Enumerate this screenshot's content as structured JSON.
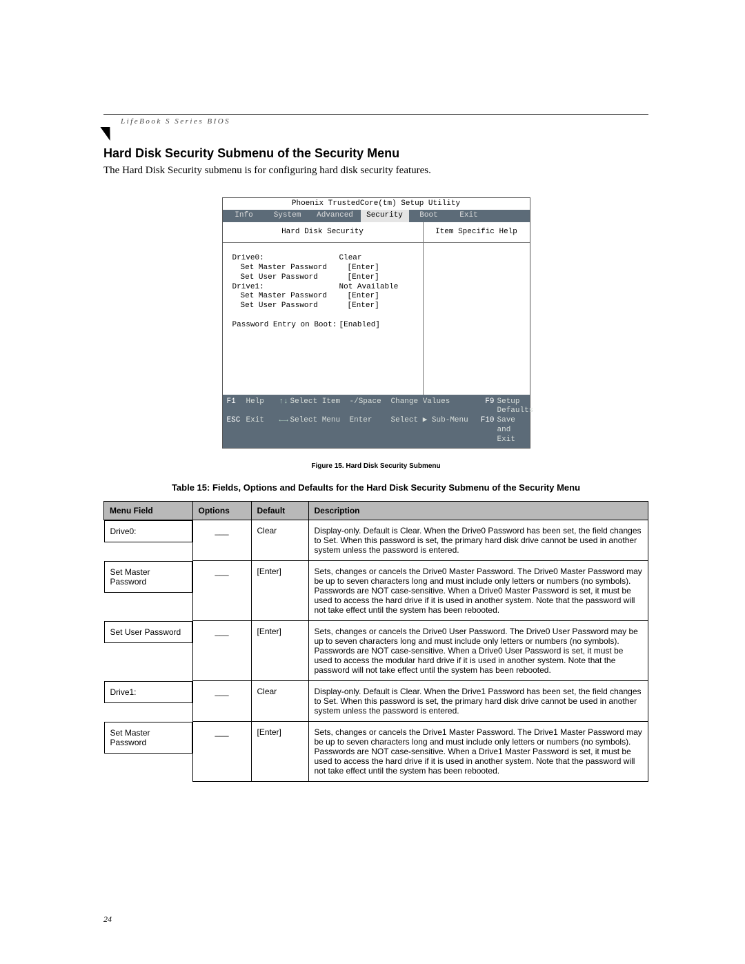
{
  "header": {
    "series": "LifeBook S Series BIOS"
  },
  "section": {
    "title": "Hard Disk Security Submenu of the Security Menu",
    "intro": "The Hard Disk Security submenu is for configuring hard disk security features."
  },
  "bios": {
    "utility_title": "Phoenix TrustedCore(tm) Setup Utility",
    "tabs": [
      "Info",
      "System",
      "Advanced",
      "Security",
      "Boot",
      "Exit"
    ],
    "active_tab": "Security",
    "left_title": "Hard Disk Security",
    "right_title": "Item Specific Help",
    "fields": [
      {
        "label": "Drive0:",
        "value": "Clear",
        "indent": false
      },
      {
        "label": "Set Master Password",
        "value": "[Enter]",
        "indent": true
      },
      {
        "label": "Set User Password",
        "value": "[Enter]",
        "indent": true
      },
      {
        "label": "Drive1:",
        "value": "Not Available",
        "indent": false
      },
      {
        "label": "Set Master Password",
        "value": "[Enter]",
        "indent": true
      },
      {
        "label": "Set User Password",
        "value": "[Enter]",
        "indent": true
      }
    ],
    "boot_field": {
      "label": "Password Entry on Boot:",
      "value": "[Enabled]"
    },
    "footer": {
      "r1": {
        "k1": "F1",
        "l1": "Help",
        "arw1": "↑↓",
        "sel1": "Select Item",
        "mk1": "-/Space",
        "act1": "Change Values",
        "fk1": "F9",
        "fl1": "Setup Defaults"
      },
      "r2": {
        "k2": "ESC",
        "l2": "Exit",
        "arw2": "←→",
        "sel2": "Select Menu",
        "mk2": "Enter",
        "act2": "Select ▶ Sub-Menu",
        "fk2": "F10",
        "fl2": "Save and Exit"
      }
    }
  },
  "figure_caption": "Figure 15.   Hard Disk Security Submenu",
  "table_caption": "Table 15: Fields, Options and Defaults for the Hard Disk Security Submenu of the Security Menu",
  "table": {
    "headers": [
      "Menu Field",
      "Options",
      "Default",
      "Description"
    ],
    "rows": [
      {
        "field": "Drive0:",
        "options": "___",
        "default": "Clear",
        "desc": "Display-only. Default is Clear. When the Drive0 Password has been set, the field changes to Set. When this password is set, the primary hard disk drive cannot be used in another system unless the password is entered."
      },
      {
        "field": "Set Master Password",
        "options": "___",
        "default": "[Enter]",
        "desc": "Sets, changes or cancels the Drive0 Master Password. The Drive0 Master Password may be up to seven characters long and must include only letters or numbers (no symbols). Passwords are NOT case-sensitive. When a Drive0 Master Password is set, it must be used to access the hard drive if it is used in another system. Note that the password will not take effect until the system has been rebooted."
      },
      {
        "field": "Set User Password",
        "options": "___",
        "default": "[Enter]",
        "desc": "Sets, changes or cancels the Drive0 User Password. The Drive0 User Password may be up to seven characters long and must include only letters or numbers (no symbols). Passwords are NOT case-sensitive. When a Drive0 User Password is set, it must be used to access the modular hard drive if it is used in another system. Note that the password will not take effect until the system has been rebooted."
      },
      {
        "field": "Drive1:",
        "options": "___",
        "default": "Clear",
        "desc": "Display-only. Default is Clear. When the Drive1 Password has been set, the field changes to Set. When this password is set, the primary hard disk drive cannot be used in another system unless the password is entered."
      },
      {
        "field": "Set Master Password",
        "options": "___",
        "default": "[Enter]",
        "desc": "Sets, changes or cancels the Drive1 Master Password. The Drive1 Master Password may be up to seven characters long and must include only letters or numbers (no symbols). Passwords are NOT case-sensitive. When a Drive1 Master Password is set, it must be used to access the hard drive if it is used in another system. Note that the password will not take effect until the system has been rebooted."
      }
    ]
  },
  "page_number": "24"
}
